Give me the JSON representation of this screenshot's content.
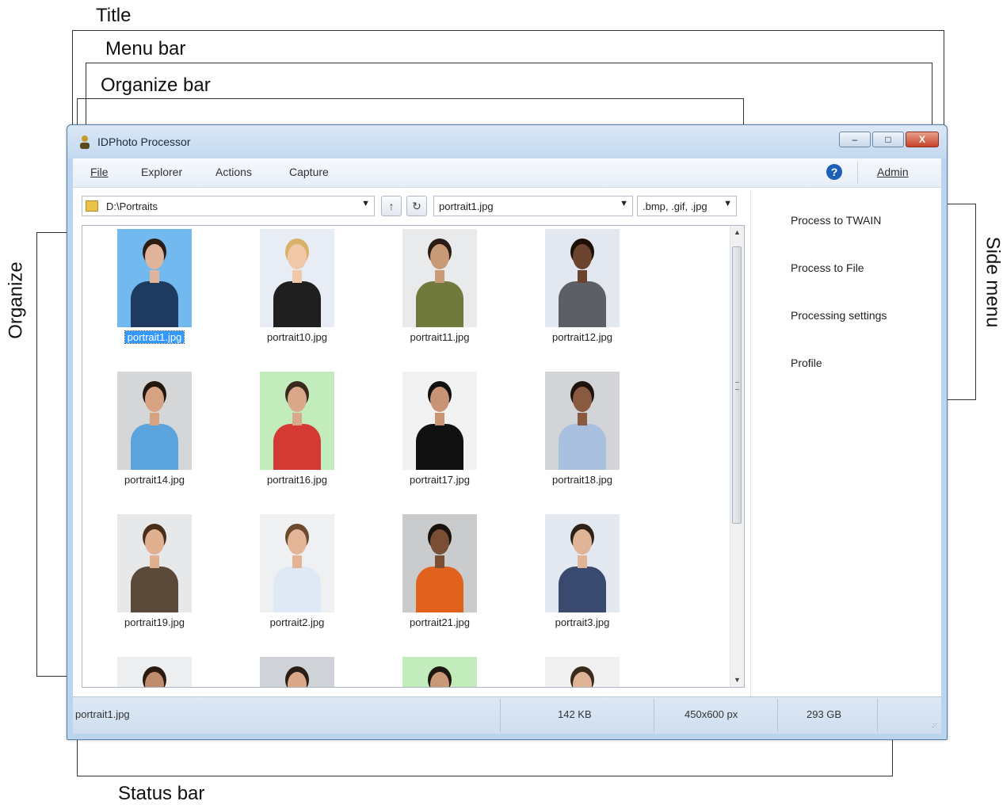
{
  "annotations": {
    "title": "Title",
    "menu_bar": "Menu bar",
    "organize_bar": "Organize bar",
    "organize": "Organize",
    "side_menu": "Side menu",
    "status_bar": "Status bar"
  },
  "window": {
    "title": "IDPhoto Processor",
    "buttons": {
      "minimize": "–",
      "maximize": "□",
      "close": "X"
    }
  },
  "menu": {
    "items": [
      "File",
      "Explorer",
      "Actions",
      "Capture"
    ],
    "help": "?",
    "admin": "Admin"
  },
  "organize_bar": {
    "path": "D:\\Portraits",
    "up_icon": "↑",
    "refresh_icon": "↻",
    "file": "portrait1.jpg",
    "filter": ".bmp, .gif, .jpg"
  },
  "thumbnails": [
    {
      "name": "portrait1.jpg",
      "selected": true,
      "bg": "#72b9ef",
      "shirt": "#1e3a5f",
      "skin": "#e0b49a",
      "hair": "#2b1d14"
    },
    {
      "name": "portrait10.jpg",
      "bg": "#e8ecf4",
      "shirt": "#1f1f1f",
      "skin": "#f0c8a8",
      "hair": "#d8b06a"
    },
    {
      "name": "portrait11.jpg",
      "bg": "#e9eaec",
      "shirt": "#6f7a3c",
      "skin": "#c89a78",
      "hair": "#2a1c12"
    },
    {
      "name": "portrait12.jpg",
      "bg": "#e2e7f0",
      "shirt": "#5c6066",
      "skin": "#6b4430",
      "hair": "#1a1008"
    },
    {
      "name": "portrait14.jpg",
      "bg": "#d4d6d8",
      "shirt": "#5aa3dc",
      "skin": "#d6a282",
      "hair": "#221810"
    },
    {
      "name": "portrait16.jpg",
      "bg": "#c3ecbd",
      "shirt": "#d43a33",
      "skin": "#d9a88a",
      "hair": "#3a2a1e"
    },
    {
      "name": "portrait17.jpg",
      "bg": "#f2f2f2",
      "shirt": "#111111",
      "skin": "#c89474",
      "hair": "#111111"
    },
    {
      "name": "portrait18.jpg",
      "bg": "#d2d4d8",
      "shirt": "#a9bfe0",
      "skin": "#8a5a40",
      "hair": "#1d130c"
    },
    {
      "name": "portrait19.jpg",
      "bg": "#e6e8ea",
      "shirt": "#5b4a3a",
      "skin": "#e0b090",
      "hair": "#4a2e1c"
    },
    {
      "name": "portrait2.jpg",
      "bg": "#eef0f2",
      "shirt": "#dfe9f5",
      "skin": "#e3b596",
      "hair": "#6b4a2e"
    },
    {
      "name": "portrait21.jpg",
      "bg": "#c9cbcd",
      "shirt": "#e0621c",
      "skin": "#7a4e34",
      "hair": "#1a120c"
    },
    {
      "name": "portrait3.jpg",
      "bg": "#e4e8f0",
      "shirt": "#3a4a6e",
      "skin": "#e0b496",
      "hair": "#2e2218"
    },
    {
      "name": "",
      "bg": "#eceef0",
      "shirt": "#444444",
      "skin": "#c08c70",
      "hair": "#2a1a10"
    },
    {
      "name": "",
      "bg": "#cfd2d6",
      "shirt": "#444444",
      "skin": "#d8a888",
      "hair": "#2a1e16"
    },
    {
      "name": "",
      "bg": "#c3ecbd",
      "shirt": "#444444",
      "skin": "#c89878",
      "hair": "#1e1610"
    },
    {
      "name": "",
      "bg": "#f0f0f0",
      "shirt": "#444444",
      "skin": "#e0b496",
      "hair": "#3a2a1c"
    }
  ],
  "side_menu": [
    "Process to TWAIN",
    "Process to File",
    "Processing settings",
    "Profile"
  ],
  "status": {
    "file": "portrait1.jpg",
    "size": "142 KB",
    "dimensions": "450x600 px",
    "free_space": "293 GB"
  },
  "colors": {
    "selection": "#3399ff",
    "help_icon": "#1b5fb6",
    "close_button": "#c8432c"
  }
}
